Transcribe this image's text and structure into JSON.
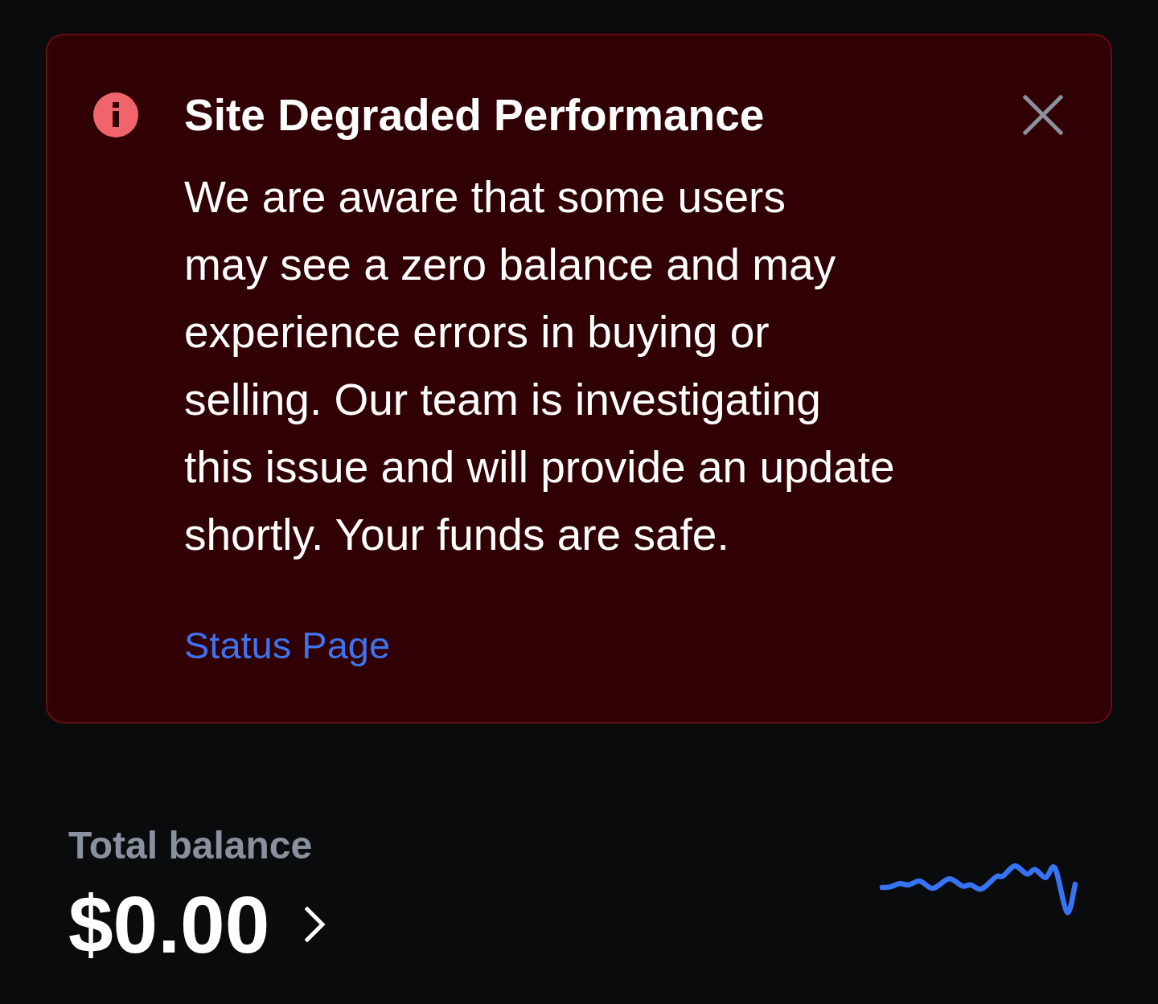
{
  "alert": {
    "title": "Site Degraded Performance",
    "message": "We are aware that some users\nmay see a zero balance and may\nexperience errors in buying or\nselling. Our team is investigating\nthis issue and will provide an update\nshortly. Your funds are safe.",
    "link": "Status Page"
  },
  "balance": {
    "label": "Total balance",
    "amount": "$0.00"
  }
}
